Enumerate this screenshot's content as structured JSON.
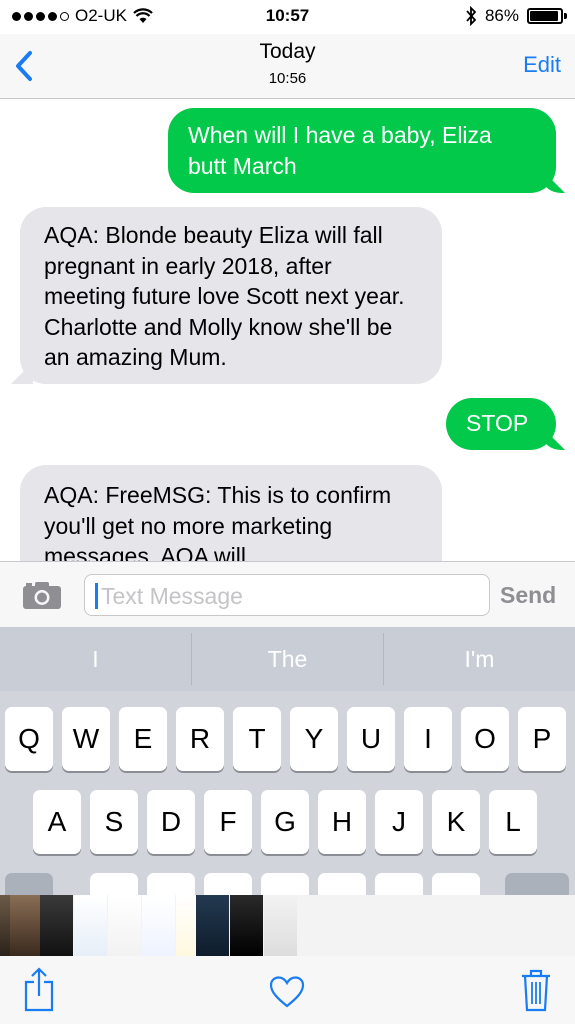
{
  "status_bar": {
    "carrier": "O2-UK",
    "time": "10:57",
    "battery": "86%"
  },
  "nav": {
    "title": "Today",
    "subtitle": "10:56",
    "edit_label": "Edit"
  },
  "messages": [
    {
      "direction": "outgoing",
      "text": "When will I have a baby, Eliza butt March"
    },
    {
      "direction": "incoming",
      "text": "AQA: Blonde beauty Eliza will fall pregnant in early 2018, after meeting future love Scott next year. Charlotte and Molly know she'll be an amazing Mum."
    },
    {
      "direction": "outgoing",
      "text": "STOP"
    },
    {
      "direction": "incoming",
      "text": "AQA: FreeMSG: This is to confirm you'll get no more marketing messages. AQA will"
    }
  ],
  "composer": {
    "placeholder": "Text Message",
    "value": "",
    "send_label": "Send"
  },
  "predictions": [
    "I",
    "The",
    "I'm"
  ],
  "keyboard": {
    "row1": [
      "Q",
      "W",
      "E",
      "R",
      "T",
      "Y",
      "U",
      "I",
      "O",
      "P"
    ],
    "row2": [
      "A",
      "S",
      "D",
      "F",
      "G",
      "H",
      "J",
      "K",
      "L"
    ]
  },
  "colors": {
    "outgoing_bubble": "#03c94b",
    "incoming_bubble": "#e5e5ea",
    "accent": "#1a7cf2"
  }
}
